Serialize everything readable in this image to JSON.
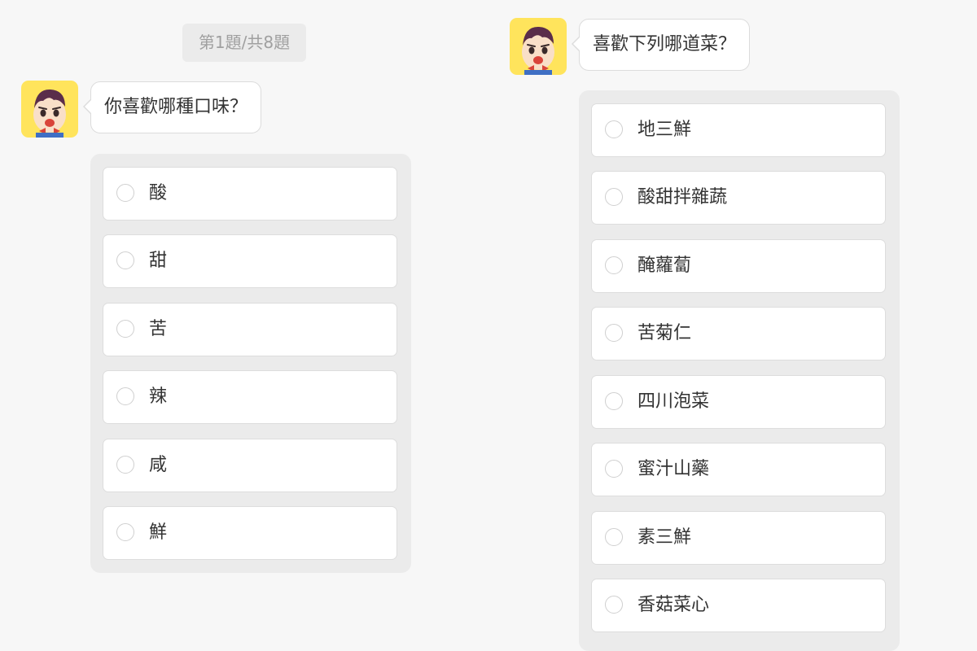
{
  "progress": {
    "text": "第1題/共8題"
  },
  "questions": [
    {
      "avatar_icon": "cartoon-boy-icon",
      "prompt": "你喜歡哪種口味？",
      "options": [
        "酸",
        "甜",
        "苦",
        "辣",
        "咸",
        "鮮"
      ]
    },
    {
      "avatar_icon": "cartoon-boy-icon",
      "prompt": "喜歡下列哪道菜？",
      "options": [
        "地三鮮",
        "酸甜拌雜蔬",
        "醃蘿蔔",
        "苦菊仁",
        "四川泡菜",
        "蜜汁山藥",
        "素三鮮",
        "香菇菜心"
      ]
    }
  ],
  "colors": {
    "avatar_bg": "#ffe45c",
    "panel_bg": "#ebebeb",
    "page_bg": "#f7f7f7"
  }
}
